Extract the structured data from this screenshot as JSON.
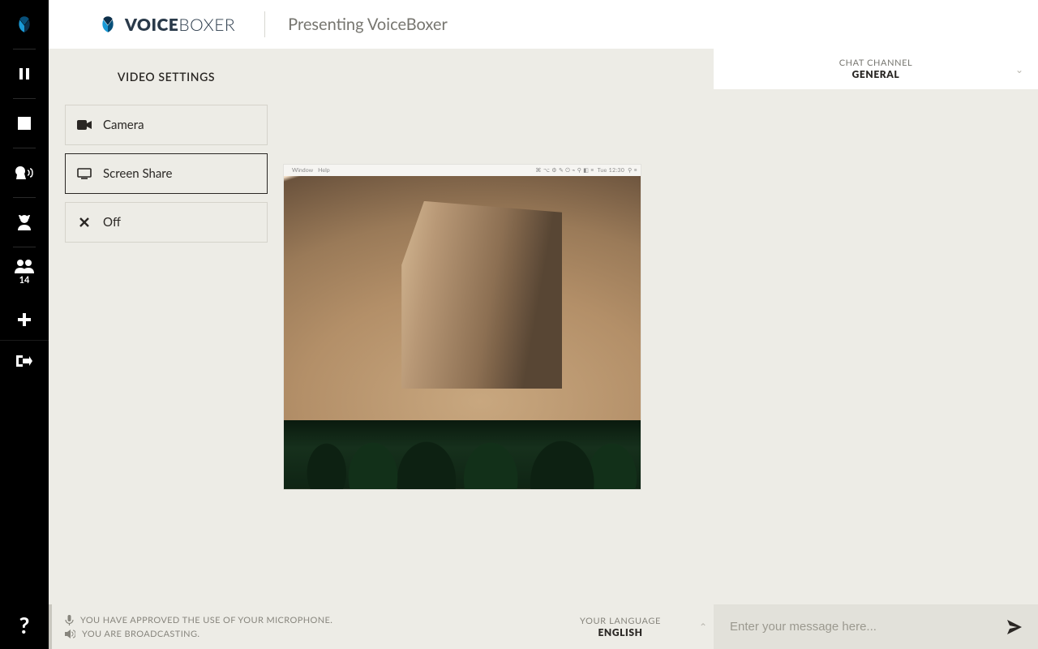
{
  "brand": {
    "bold": "VOICE",
    "thin": "BOXER"
  },
  "header": {
    "title": "Presenting VoiceBoxer"
  },
  "rail": {
    "attendee_count": "14"
  },
  "settings": {
    "title": "VIDEO SETTINGS",
    "camera": "Camera",
    "screen_share": "Screen Share",
    "off": "Off"
  },
  "preview_menubar": {
    "left": [
      "",
      "Window",
      "Help"
    ],
    "right": [
      "Tue 12:30"
    ]
  },
  "chat": {
    "channel_label": "CHAT CHANNEL",
    "channel_value": "GENERAL",
    "input_placeholder": "Enter your message here..."
  },
  "status": {
    "mic": "YOU HAVE APPROVED THE USE OF YOUR MICROPHONE.",
    "broadcast": "YOU ARE BROADCASTING."
  },
  "language": {
    "label": "YOUR LANGUAGE",
    "value": "ENGLISH"
  }
}
